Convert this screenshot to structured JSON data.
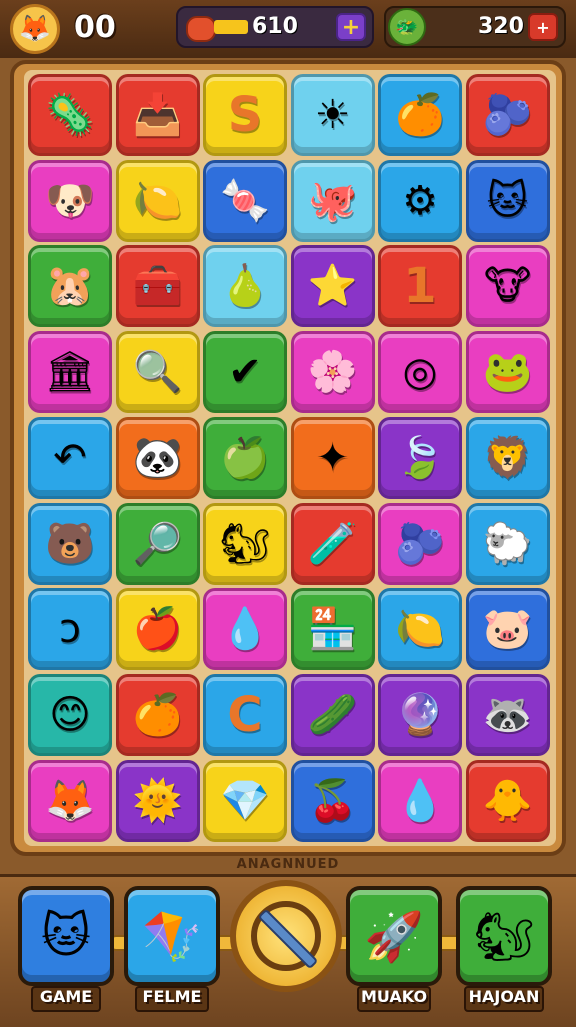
{
  "hud": {
    "avatar_icon": "fox-face-icon",
    "score": "00",
    "coins": "610",
    "coins_plus": "+",
    "gem_icon": "green-dragon-icon",
    "gems": "320",
    "gems_plus": "+"
  },
  "board": {
    "columns": 6,
    "rows": 9,
    "tiles": [
      {
        "color": "#e53b2f",
        "icon": "🦠",
        "name": "green-blob"
      },
      {
        "color": "#e53b2f",
        "icon": "📥",
        "name": "green-box"
      },
      {
        "color": "#f7d31a",
        "icon": "S",
        "name": "letter-s"
      },
      {
        "color": "#6fd1ee",
        "icon": "☀",
        "name": "sun"
      },
      {
        "color": "#2ba6e8",
        "icon": "🍊",
        "name": "orange-drop"
      },
      {
        "color": "#e53b2f",
        "icon": "🫐",
        "name": "blue-blob"
      },
      {
        "color": "#e93ec1",
        "icon": "🐶",
        "name": "dog-face"
      },
      {
        "color": "#f7d31a",
        "icon": "🍋",
        "name": "yellow-fruit"
      },
      {
        "color": "#2f6fdc",
        "icon": "🍬",
        "name": "pink-candy"
      },
      {
        "color": "#6fd1ee",
        "icon": "🐙",
        "name": "octopus"
      },
      {
        "color": "#2ba6e8",
        "icon": "⚙",
        "name": "green-gear"
      },
      {
        "color": "#2f6fdc",
        "icon": "🐱",
        "name": "yellow-cat"
      },
      {
        "color": "#3fae3a",
        "icon": "🐹",
        "name": "hamster-face"
      },
      {
        "color": "#e53b2f",
        "icon": "🧰",
        "name": "toolbox"
      },
      {
        "color": "#6fd1ee",
        "icon": "🍐",
        "name": "green-drop"
      },
      {
        "color": "#8a34c8",
        "icon": "⭐",
        "name": "star"
      },
      {
        "color": "#e53b2f",
        "icon": "1",
        "name": "number-one"
      },
      {
        "color": "#e93ec1",
        "icon": "🐮",
        "name": "cloud-face"
      },
      {
        "color": "#e93ec1",
        "icon": "🏛",
        "name": "building"
      },
      {
        "color": "#f7d31a",
        "icon": "🔍",
        "name": "magnifier"
      },
      {
        "color": "#3fae3a",
        "icon": "✔",
        "name": "check-mark"
      },
      {
        "color": "#e93ec1",
        "icon": "🌸",
        "name": "flower"
      },
      {
        "color": "#e93ec1",
        "icon": "◎",
        "name": "green-ring"
      },
      {
        "color": "#e93ec1",
        "icon": "🐸",
        "name": "green-creature"
      },
      {
        "color": "#2ba6e8",
        "icon": "↶",
        "name": "curl-arrow"
      },
      {
        "color": "#f26d1c",
        "icon": "🐼",
        "name": "bear-ring"
      },
      {
        "color": "#3fae3a",
        "icon": "🍏",
        "name": "green-apple"
      },
      {
        "color": "#f26d1c",
        "icon": "✦",
        "name": "blue-star"
      },
      {
        "color": "#8a34c8",
        "icon": "🍃",
        "name": "green-leaf"
      },
      {
        "color": "#2ba6e8",
        "icon": "🦁",
        "name": "lion-girl"
      },
      {
        "color": "#2ba6e8",
        "icon": "🐻",
        "name": "bear-face"
      },
      {
        "color": "#3fae3a",
        "icon": "🔎",
        "name": "green-magnifier"
      },
      {
        "color": "#f7d31a",
        "icon": "🐿",
        "name": "squirrel"
      },
      {
        "color": "#e53b2f",
        "icon": "🧪",
        "name": "flask"
      },
      {
        "color": "#e93ec1",
        "icon": "🫐",
        "name": "blue-berry"
      },
      {
        "color": "#2ba6e8",
        "icon": "🐑",
        "name": "sheep"
      },
      {
        "color": "#2ba6e8",
        "icon": "ↄ",
        "name": "orange-hook"
      },
      {
        "color": "#f7d31a",
        "icon": "🍎",
        "name": "blue-apple"
      },
      {
        "color": "#e93ec1",
        "icon": "💧",
        "name": "blue-heart"
      },
      {
        "color": "#3fae3a",
        "icon": "🏪",
        "name": "shop"
      },
      {
        "color": "#2ba6e8",
        "icon": "🍋",
        "name": "yellow-drop"
      },
      {
        "color": "#2f6fdc",
        "icon": "🐷",
        "name": "pink-monster"
      },
      {
        "color": "#27b7a8",
        "icon": "😊",
        "name": "yellow-smile"
      },
      {
        "color": "#e53b2f",
        "icon": "🍊",
        "name": "orange-fruit"
      },
      {
        "color": "#2ba6e8",
        "icon": "C",
        "name": "letter-c"
      },
      {
        "color": "#8a34c8",
        "icon": "🥒",
        "name": "green-pod"
      },
      {
        "color": "#8a34c8",
        "icon": "🔮",
        "name": "striped-ball"
      },
      {
        "color": "#8a34c8",
        "icon": "🦝",
        "name": "raccoon"
      },
      {
        "color": "#e93ec1",
        "icon": "🦊",
        "name": "fox-runner"
      },
      {
        "color": "#8a34c8",
        "icon": "🌞",
        "name": "sun-face"
      },
      {
        "color": "#f7d31a",
        "icon": "💎",
        "name": "blue-gem"
      },
      {
        "color": "#2f6fdc",
        "icon": "🍒",
        "name": "red-cherry"
      },
      {
        "color": "#e93ec1",
        "icon": "💧",
        "name": "water-drop"
      },
      {
        "color": "#e53b2f",
        "icon": "🐥",
        "name": "yellow-bird"
      }
    ]
  },
  "level_label": "ANAGNNUED",
  "dock": {
    "buttons": [
      {
        "label": "GAME",
        "color": "#2f7fe0",
        "icon": "🐱",
        "icon_name": "cat-icon"
      },
      {
        "label": "FELME",
        "color": "#2ba6e8",
        "icon": "🪁",
        "icon_name": "kite-icon"
      },
      {
        "label": "MUAKO",
        "color": "#3fae3a",
        "icon": "🚀",
        "icon_name": "rocket-icon"
      },
      {
        "label": "HAJOAN",
        "color": "#3fae3a",
        "icon": "🐿",
        "icon_name": "squirrel-icon"
      }
    ],
    "center_icon": "no-entry-icon"
  }
}
